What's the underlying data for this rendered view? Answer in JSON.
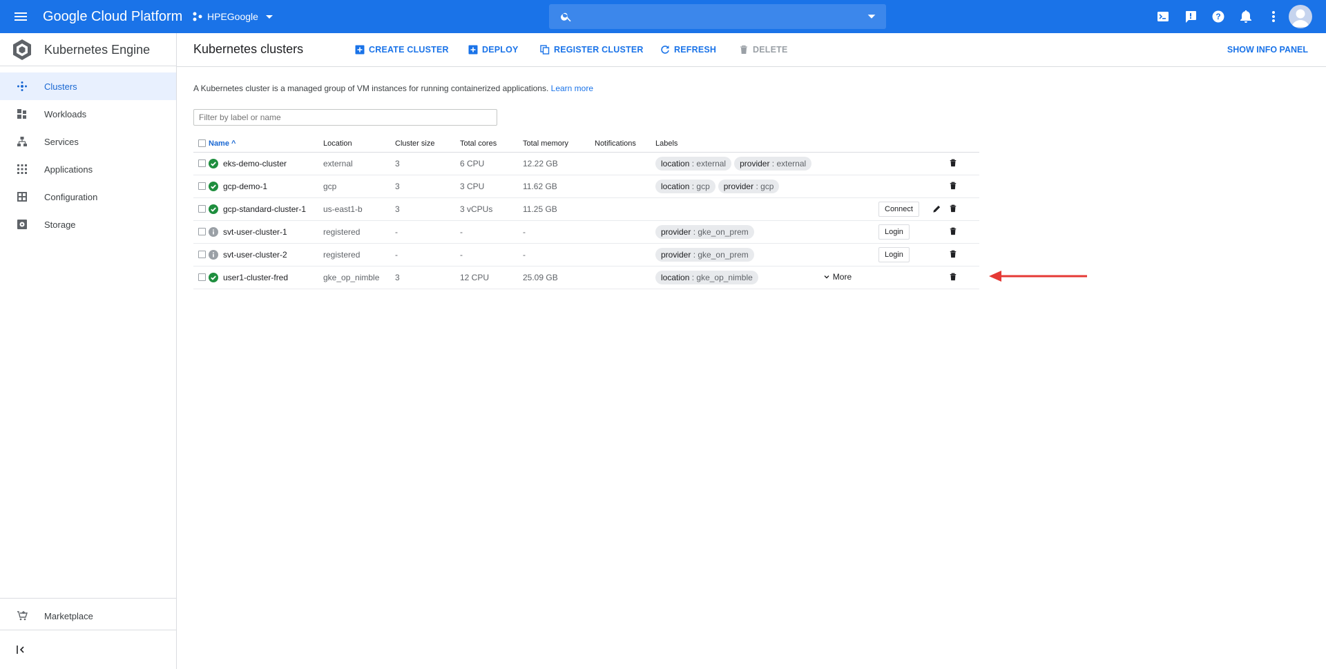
{
  "topbar": {
    "brand": "Google Cloud Platform",
    "project": "HPEGoogle",
    "search_placeholder": ""
  },
  "sidebar": {
    "product_title": "Kubernetes Engine",
    "items": [
      {
        "label": "Clusters",
        "icon": "clusters-icon",
        "active": true
      },
      {
        "label": "Workloads",
        "icon": "workloads-icon",
        "active": false
      },
      {
        "label": "Services",
        "icon": "services-icon",
        "active": false
      },
      {
        "label": "Applications",
        "icon": "applications-icon",
        "active": false
      },
      {
        "label": "Configuration",
        "icon": "configuration-icon",
        "active": false
      },
      {
        "label": "Storage",
        "icon": "storage-icon",
        "active": false
      }
    ],
    "marketplace": "Marketplace"
  },
  "header": {
    "title": "Kubernetes clusters",
    "actions": {
      "create": "CREATE CLUSTER",
      "deploy": "DEPLOY",
      "register": "REGISTER CLUSTER",
      "refresh": "REFRESH",
      "delete": "DELETE"
    },
    "info_panel": "SHOW INFO PANEL"
  },
  "content": {
    "description": "A Kubernetes cluster is a managed group of VM instances for running containerized applications.",
    "learn_more": "Learn more",
    "filter_placeholder": "Filter by label or name"
  },
  "table": {
    "columns": [
      "Name",
      "Location",
      "Cluster size",
      "Total cores",
      "Total memory",
      "Notifications",
      "Labels"
    ],
    "sort_indicator": "^",
    "rows": [
      {
        "status": "ok",
        "name": "eks-demo-cluster",
        "location": "external",
        "size": "3",
        "cores": "6 CPU",
        "memory": "12.22 GB",
        "notifications": "",
        "labels": [
          {
            "k": "location",
            "v": "external"
          },
          {
            "k": "provider",
            "v": "external"
          }
        ],
        "action": "",
        "more": "",
        "edit": false
      },
      {
        "status": "ok",
        "name": "gcp-demo-1",
        "location": "gcp",
        "size": "3",
        "cores": "3 CPU",
        "memory": "11.62 GB",
        "notifications": "",
        "labels": [
          {
            "k": "location",
            "v": "gcp"
          },
          {
            "k": "provider",
            "v": "gcp"
          }
        ],
        "action": "",
        "more": "",
        "edit": false
      },
      {
        "status": "ok",
        "name": "gcp-standard-cluster-1",
        "location": "us-east1-b",
        "size": "3",
        "cores": "3 vCPUs",
        "memory": "11.25 GB",
        "notifications": "",
        "labels": [],
        "action": "Connect",
        "more": "",
        "edit": true
      },
      {
        "status": "info",
        "name": "svt-user-cluster-1",
        "location": "registered",
        "size": "-",
        "cores": "-",
        "memory": "-",
        "notifications": "",
        "labels": [
          {
            "k": "provider",
            "v": "gke_on_prem"
          }
        ],
        "action": "Login",
        "more": "",
        "edit": false
      },
      {
        "status": "info",
        "name": "svt-user-cluster-2",
        "location": "registered",
        "size": "-",
        "cores": "-",
        "memory": "-",
        "notifications": "",
        "labels": [
          {
            "k": "provider",
            "v": "gke_on_prem"
          }
        ],
        "action": "Login",
        "more": "",
        "edit": false
      },
      {
        "status": "ok",
        "name": "user1-cluster-fred",
        "location": "gke_op_nimble",
        "size": "3",
        "cores": "12 CPU",
        "memory": "25.09 GB",
        "notifications": "",
        "labels": [
          {
            "k": "location",
            "v": "gke_op_nimble"
          }
        ],
        "action": "",
        "more": "More",
        "edit": false
      }
    ]
  },
  "colors": {
    "brand_blue": "#1a73e8",
    "ok_green": "#1e8e3e",
    "info_grey": "#9aa0a6",
    "annotation_red": "#e53935"
  }
}
